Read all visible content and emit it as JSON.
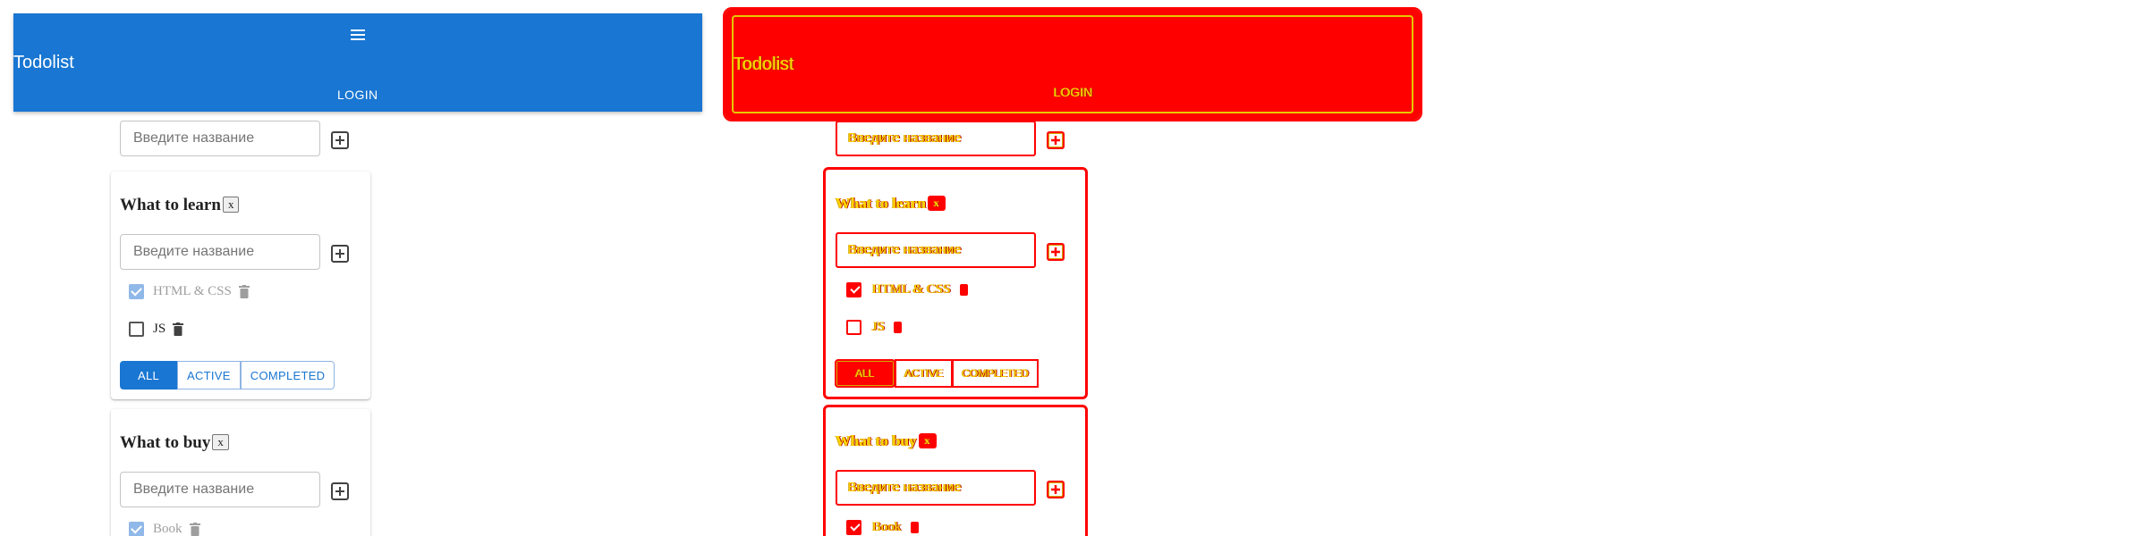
{
  "appbar": {
    "title": "Todolist",
    "login_label": "LOGIN",
    "color": "#1976d2",
    "menu_icon": "menu-icon"
  },
  "add_list": {
    "placeholder": "Введите название",
    "add_icon": "add-box-icon"
  },
  "lists": [
    {
      "title": "What to learn",
      "delete_label": "x",
      "input_placeholder": "Введите название",
      "tasks": [
        {
          "title": "HTML & CSS",
          "done": true
        },
        {
          "title": "JS",
          "done": false
        }
      ],
      "filters": [
        "ALL",
        "ACTIVE",
        "COMPLETED"
      ],
      "active_filter": "ALL"
    },
    {
      "title": "What to buy",
      "delete_label": "x",
      "input_placeholder": "Введите название",
      "tasks": [
        {
          "title": "Book",
          "done": true
        }
      ]
    }
  ],
  "debug_overlay": {
    "outline_color": "#ff0000",
    "text_color": "#ffd400"
  }
}
